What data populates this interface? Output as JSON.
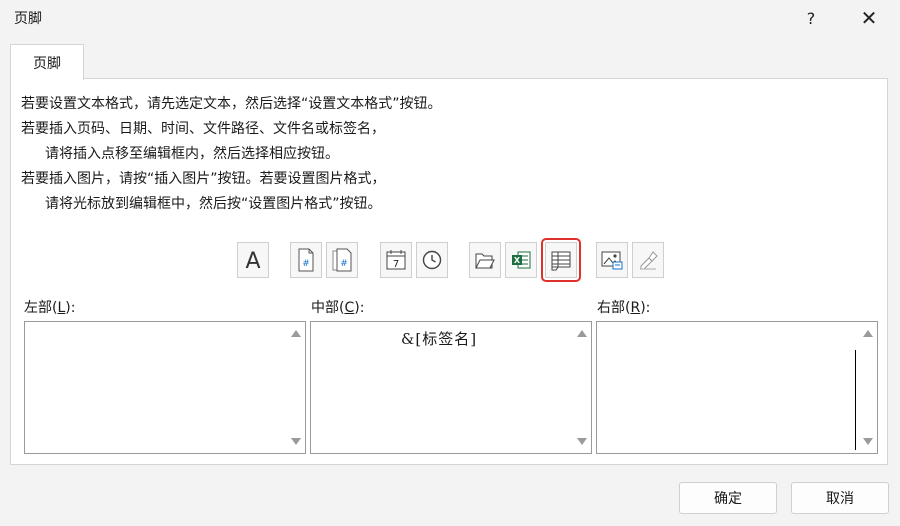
{
  "dialog": {
    "title": "页脚",
    "help_label": "?",
    "close_label": "✕"
  },
  "tab": {
    "label": "页脚"
  },
  "instructions": [
    "若要设置文本格式，请先选定文本，然后选择“设置文本格式”按钮。",
    "若要插入页码、日期、时间、文件路径、文件名或标签名，",
    "请将插入点移至编辑框内，然后选择相应按钮。",
    "若要插入图片，请按“插入图片”按钮。若要设置图片格式，",
    "请将光标放到编辑框中，然后按“设置图片格式”按钮。"
  ],
  "toolbar": [
    {
      "icon": "format-text-icon"
    },
    {
      "icon": "insert-page-number-icon"
    },
    {
      "icon": "insert-page-count-icon"
    },
    {
      "icon": "insert-date-icon"
    },
    {
      "icon": "insert-time-icon"
    },
    {
      "icon": "insert-file-path-icon"
    },
    {
      "icon": "insert-file-name-icon"
    },
    {
      "icon": "insert-sheet-name-icon",
      "highlighted": true,
      "highlight_color": "#e0302a"
    },
    {
      "icon": "insert-picture-icon"
    },
    {
      "icon": "format-picture-icon"
    }
  ],
  "sections": {
    "left": {
      "label_prefix": "左部(",
      "accel": "L",
      "label_suffix": "):",
      "content": ""
    },
    "center": {
      "label_prefix": "中部(",
      "accel": "C",
      "label_suffix": "):",
      "content": "&[标签名]"
    },
    "right": {
      "label_prefix": "右部(",
      "accel": "R",
      "label_suffix": "):",
      "content": ""
    }
  },
  "buttons": {
    "ok": "确定",
    "cancel": "取消"
  }
}
